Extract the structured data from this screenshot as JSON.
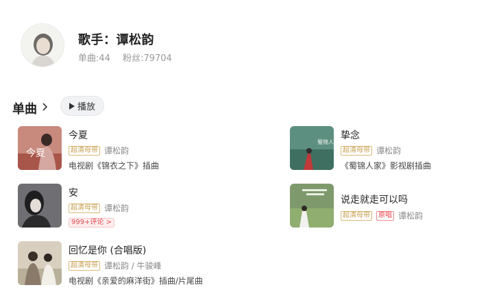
{
  "artist": {
    "name": "歌手：谭松韵",
    "singles_count": "单曲:44",
    "fans_count": "粉丝:79704"
  },
  "section": {
    "title": "单曲",
    "play_label": "播放"
  },
  "songs": [
    {
      "title": "今夏",
      "cover_text": "今夏",
      "quality_tag": "超清母带",
      "artist": "谭松韵",
      "desc": "电视剧《锦衣之下》插曲"
    },
    {
      "title": "挚念",
      "cover_text": "蜀锦人家",
      "quality_tag": "超清母带",
      "artist": "谭松韵",
      "desc": "《蜀锦人家》影视剧插曲"
    },
    {
      "title": "安",
      "quality_tag": "超清母带",
      "artist": "谭松韵",
      "comment_badge": "999+评论 >"
    },
    {
      "title": "说走就走可以吗",
      "quality_tag": "超清母带",
      "original_tag": "原唱",
      "artist": "谭松韵"
    },
    {
      "title": "回忆是你 (合唱版)",
      "quality_tag": "超清母带",
      "artist": "谭松韵 / 牛骏峰",
      "desc": "电视剧《亲爱的麻洋街》插曲/片尾曲"
    }
  ],
  "icons": {
    "section_chevron": "chevron-right-icon",
    "play": "play-icon"
  },
  "colors": {
    "quality_tag": "#c9a052",
    "original_tag": "#e5484d",
    "comment_badge": "#e5484d"
  }
}
